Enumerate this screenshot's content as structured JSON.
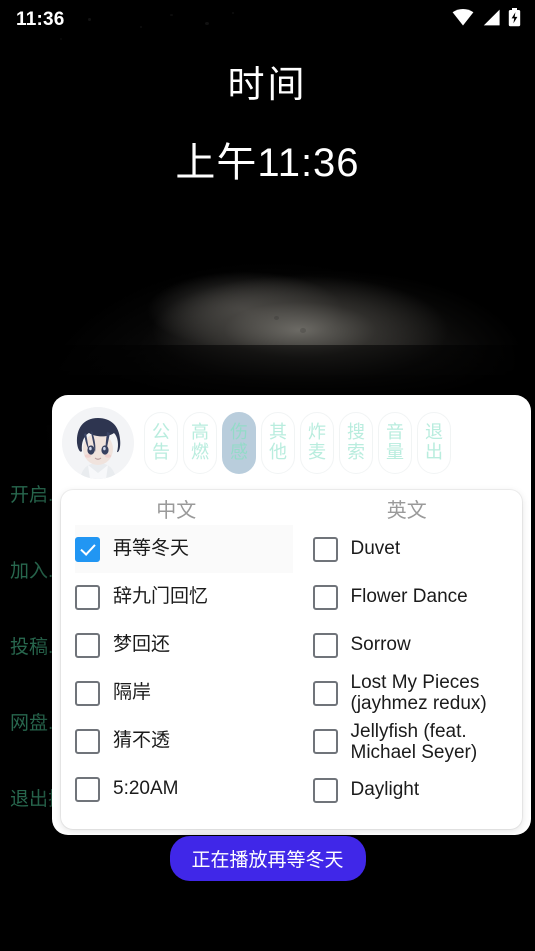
{
  "status_bar": {
    "time": "11:36",
    "icons": [
      "wifi-icon",
      "cellular-signal-icon",
      "battery-charging-icon"
    ]
  },
  "clock_widget": {
    "title": "时间",
    "time": "上午11:36"
  },
  "background_menu": {
    "items": [
      {
        "label": "开启..."
      },
      {
        "label": "加入..."
      },
      {
        "label": "投稿..."
      },
      {
        "label": "网盘..."
      },
      {
        "label": "退出插件"
      }
    ],
    "color": "#2f7a5c"
  },
  "panel": {
    "avatar": {
      "name": "user-avatar",
      "description": "anime boy with navy hair"
    },
    "tabs": [
      {
        "label": "公告",
        "line1": "公",
        "line2": "告",
        "selected": false
      },
      {
        "label": "高燃",
        "line1": "高",
        "line2": "燃",
        "selected": false
      },
      {
        "label": "伤感",
        "line1": "伤",
        "line2": "感",
        "selected": true
      },
      {
        "label": "其他",
        "line1": "其",
        "line2": "他",
        "selected": false
      },
      {
        "label": "炸麦",
        "line1": "炸",
        "line2": "麦",
        "selected": false
      },
      {
        "label": "搜索",
        "line1": "搜",
        "line2": "索",
        "selected": false
      },
      {
        "label": "音量",
        "line1": "音",
        "line2": "量",
        "selected": false
      },
      {
        "label": "退出",
        "line1": "退",
        "line2": "出",
        "selected": false
      }
    ],
    "selected_tab_color": "#b6cbdb",
    "tab_text_color": "#a6e8d6",
    "columns": [
      {
        "header": "中文",
        "songs": [
          {
            "label": "再等冬天",
            "checked": true
          },
          {
            "label": "辞九门回忆",
            "checked": false
          },
          {
            "label": "梦回还",
            "checked": false
          },
          {
            "label": "隔岸",
            "checked": false
          },
          {
            "label": "猜不透",
            "checked": false
          },
          {
            "label": "5:20AM",
            "checked": false
          }
        ]
      },
      {
        "header": "英文",
        "songs": [
          {
            "label": "Duvet",
            "checked": false
          },
          {
            "label": "Flower Dance",
            "checked": false
          },
          {
            "label": "Sorrow",
            "checked": false
          },
          {
            "label": "Lost My Pieces (jayhmez redux)",
            "checked": false
          },
          {
            "label": "Jellyfish (feat. Michael Seyer)",
            "checked": false
          },
          {
            "label": "Daylight",
            "checked": false
          }
        ]
      }
    ],
    "checkbox_checked_color": "#2196f3"
  },
  "toast": {
    "message": "正在播放再等冬天",
    "background": "#4027e8"
  }
}
